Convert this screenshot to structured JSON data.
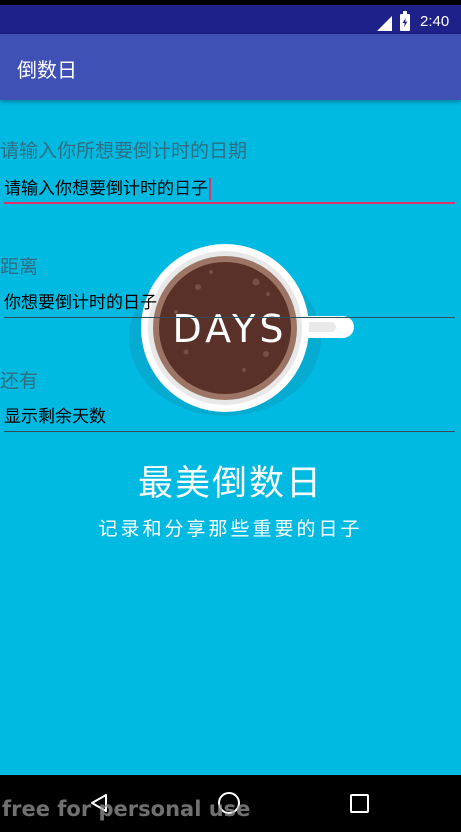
{
  "status_bar": {
    "time": "2:40",
    "signal_icon": "signal-icon",
    "battery_icon": "battery-charging-icon"
  },
  "app_bar": {
    "title": "倒数日",
    "color": "#3f51b5"
  },
  "form": {
    "date_label": "请输入你所想要倒计时的日期",
    "date_input_value": "请输入你想要倒计时的日子",
    "distance_label": "距离",
    "distance_value": "你想要倒计时的日子",
    "remaining_label": "还有",
    "remaining_value": "显示剩余天数"
  },
  "background": {
    "illustration_text": "DAYS",
    "slogan_main": "最美倒数日",
    "slogan_sub": "记录和分享那些重要的日子",
    "color": "#00bae2"
  },
  "nav_bar": {
    "back_icon": "back-triangle-icon",
    "home_icon": "home-circle-icon",
    "recents_icon": "recents-square-icon"
  },
  "watermark": "free for personal use"
}
